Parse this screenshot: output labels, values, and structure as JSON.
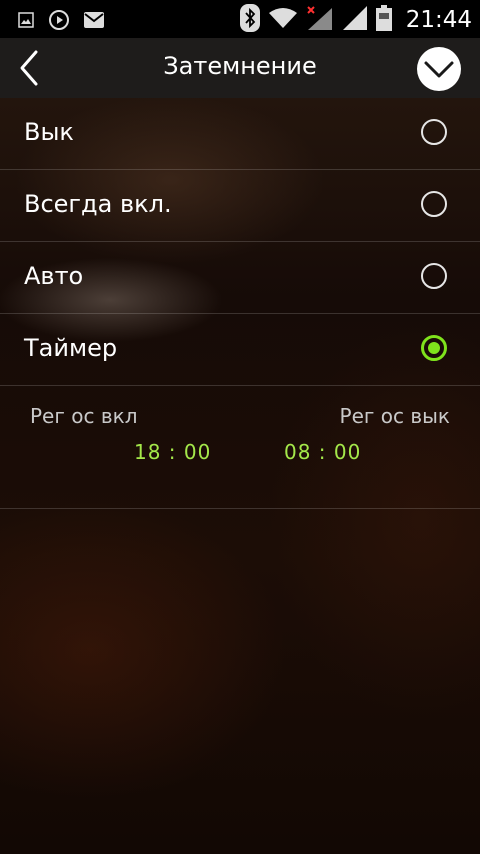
{
  "status_bar": {
    "time": "21:44",
    "icons_left": [
      "image-icon",
      "play-icon",
      "mail-icon"
    ],
    "icons_right": [
      "bluetooth-icon",
      "wifi-icon",
      "signal-icon-no-service",
      "signal-icon",
      "battery-icon"
    ]
  },
  "header": {
    "title": "Затемнение",
    "back_icon": "chevron-left-icon",
    "confirm_icon": "chevron-down-icon"
  },
  "options": [
    {
      "label": "Вык",
      "selected": false
    },
    {
      "label": "Всегда вкл.",
      "selected": false
    },
    {
      "label": "Авто",
      "selected": false
    },
    {
      "label": "Таймер",
      "selected": true
    }
  ],
  "timer": {
    "on_label": "Рег ос вкл",
    "off_label": "Рег ос вык",
    "on_time": "18 : 00",
    "off_time": "08 : 00"
  },
  "colors": {
    "accent": "#7fe31c",
    "time_value": "#a4e84a",
    "header_bg": "#1e1c1b"
  }
}
